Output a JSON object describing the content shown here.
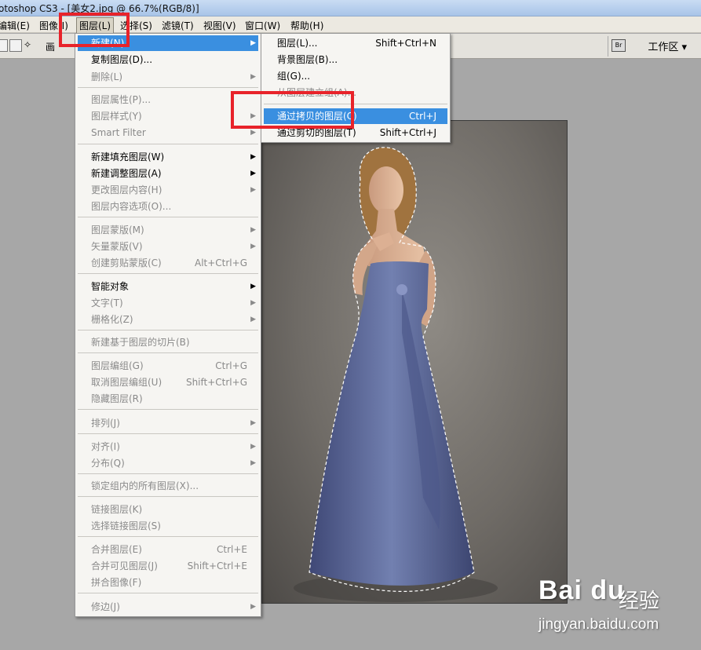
{
  "window": {
    "title": "otoshop CS3 - [美女2.jpg @ 66.7%(RGB/8)]"
  },
  "menubar": {
    "items": [
      "编辑(E)",
      "图像(I)",
      "图层(L)",
      "选择(S)",
      "滤镜(T)",
      "视图(V)",
      "窗口(W)",
      "帮助(H)"
    ],
    "active": "图层(L)"
  },
  "toolbar": {
    "workspace_label": "工作区 ▾",
    "btn_label": "画"
  },
  "layer_menu": {
    "items": [
      {
        "label": "新建(N)",
        "shortcut": "",
        "arrow": true,
        "enabled": true,
        "highlighted": true
      },
      {
        "label": "复制图层(D)...",
        "shortcut": "",
        "arrow": false,
        "enabled": true
      },
      {
        "label": "删除(L)",
        "shortcut": "",
        "arrow": true,
        "enabled": false
      },
      {
        "label": "图层属性(P)...",
        "shortcut": "",
        "arrow": false,
        "enabled": false
      },
      {
        "label": "图层样式(Y)",
        "shortcut": "",
        "arrow": true,
        "enabled": false
      },
      {
        "label": "Smart Filter",
        "shortcut": "",
        "arrow": true,
        "enabled": false
      },
      {
        "label": "新建填充图层(W)",
        "shortcut": "",
        "arrow": true,
        "enabled": true
      },
      {
        "label": "新建调整图层(A)",
        "shortcut": "",
        "arrow": true,
        "enabled": true
      },
      {
        "label": "更改图层内容(H)",
        "shortcut": "",
        "arrow": true,
        "enabled": false
      },
      {
        "label": "图层内容选项(O)...",
        "shortcut": "",
        "arrow": false,
        "enabled": false
      },
      {
        "label": "图层蒙版(M)",
        "shortcut": "",
        "arrow": true,
        "enabled": false
      },
      {
        "label": "矢量蒙版(V)",
        "shortcut": "",
        "arrow": true,
        "enabled": false
      },
      {
        "label": "创建剪贴蒙版(C)",
        "shortcut": "Alt+Ctrl+G",
        "arrow": false,
        "enabled": false
      },
      {
        "label": "智能对象",
        "shortcut": "",
        "arrow": true,
        "enabled": true
      },
      {
        "label": "文字(T)",
        "shortcut": "",
        "arrow": true,
        "enabled": false
      },
      {
        "label": "栅格化(Z)",
        "shortcut": "",
        "arrow": true,
        "enabled": false
      },
      {
        "label": "新建基于图层的切片(B)",
        "shortcut": "",
        "arrow": false,
        "enabled": false
      },
      {
        "label": "图层编组(G)",
        "shortcut": "Ctrl+G",
        "arrow": false,
        "enabled": false
      },
      {
        "label": "取消图层编组(U)",
        "shortcut": "Shift+Ctrl+G",
        "arrow": false,
        "enabled": false
      },
      {
        "label": "隐藏图层(R)",
        "shortcut": "",
        "arrow": false,
        "enabled": false
      },
      {
        "label": "排列(J)",
        "shortcut": "",
        "arrow": true,
        "enabled": false
      },
      {
        "label": "对齐(I)",
        "shortcut": "",
        "arrow": true,
        "enabled": false
      },
      {
        "label": "分布(Q)",
        "shortcut": "",
        "arrow": true,
        "enabled": false
      },
      {
        "label": "锁定组内的所有图层(X)...",
        "shortcut": "",
        "arrow": false,
        "enabled": false
      },
      {
        "label": "链接图层(K)",
        "shortcut": "",
        "arrow": false,
        "enabled": false
      },
      {
        "label": "选择链接图层(S)",
        "shortcut": "",
        "arrow": false,
        "enabled": false
      },
      {
        "label": "合并图层(E)",
        "shortcut": "Ctrl+E",
        "arrow": false,
        "enabled": false
      },
      {
        "label": "合并可见图层(J)",
        "shortcut": "Shift+Ctrl+E",
        "arrow": false,
        "enabled": false
      },
      {
        "label": "拼合图像(F)",
        "shortcut": "",
        "arrow": false,
        "enabled": false
      },
      {
        "label": "修边(J)",
        "shortcut": "",
        "arrow": true,
        "enabled": false
      }
    ]
  },
  "new_submenu": {
    "items": [
      {
        "label": "图层(L)...",
        "shortcut": "Shift+Ctrl+N",
        "enabled": true
      },
      {
        "label": "背景图层(B)...",
        "shortcut": "",
        "enabled": true
      },
      {
        "label": "组(G)...",
        "shortcut": "",
        "enabled": true
      },
      {
        "label": "从图层建立组(A)...",
        "shortcut": "",
        "enabled": false
      },
      {
        "label": "通过拷贝的图层(C)",
        "shortcut": "Ctrl+J",
        "enabled": true,
        "highlighted": true
      },
      {
        "label": "通过剪切的图层(T)",
        "shortcut": "Shift+Ctrl+J",
        "enabled": true
      }
    ]
  },
  "watermark": {
    "logo": "Bai du",
    "text": "经验",
    "url": "jingyan.baidu.com"
  },
  "colors": {
    "highlight": "#3a8fe0",
    "annotation": "#e8232a",
    "dress": "#5d6a9a"
  }
}
